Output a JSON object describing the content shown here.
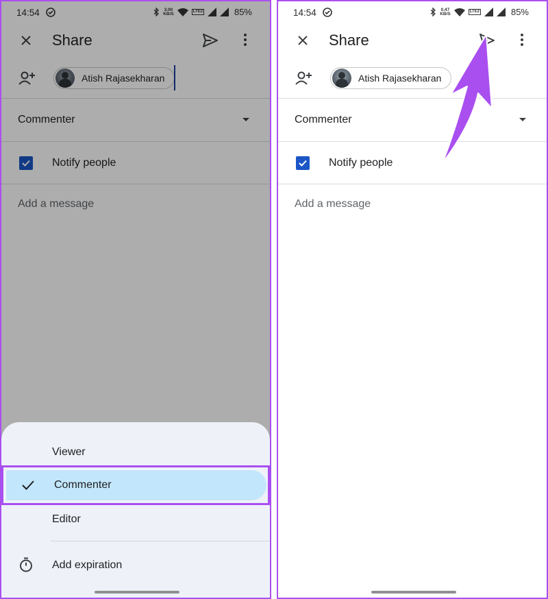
{
  "colors": {
    "accent": "#a94ff0",
    "checkbox": "#1a56c6",
    "selection": "#c2e6fb"
  },
  "left": {
    "status": {
      "time": "14:54",
      "speed_value": "3.00",
      "speed_unit": "KB/S",
      "network": "LTE2",
      "battery": "85%"
    },
    "header": {
      "title": "Share"
    },
    "recipient": {
      "name": "Atish Rajasekharan"
    },
    "role": {
      "label": "Commenter"
    },
    "notify": {
      "label": "Notify people",
      "checked": true
    },
    "message": {
      "placeholder": "Add a message"
    },
    "sheet": {
      "options": [
        "Viewer",
        "Commenter",
        "Editor"
      ],
      "selected": "Commenter",
      "expiration": "Add expiration"
    }
  },
  "right": {
    "status": {
      "time": "14:54",
      "speed_value": "0.47",
      "speed_unit": "KB/S",
      "network": "LTE2",
      "battery": "85%"
    },
    "header": {
      "title": "Share"
    },
    "recipient": {
      "name": "Atish Rajasekharan"
    },
    "role": {
      "label": "Commenter"
    },
    "notify": {
      "label": "Notify people",
      "checked": true
    },
    "message": {
      "placeholder": "Add a message"
    }
  },
  "icons": [
    "close-icon",
    "send-icon",
    "more-vert-icon",
    "person-add-icon",
    "dropdown-caret-icon",
    "checkbox-icon",
    "check-icon",
    "timer-icon",
    "arrow-annotation-icon"
  ]
}
